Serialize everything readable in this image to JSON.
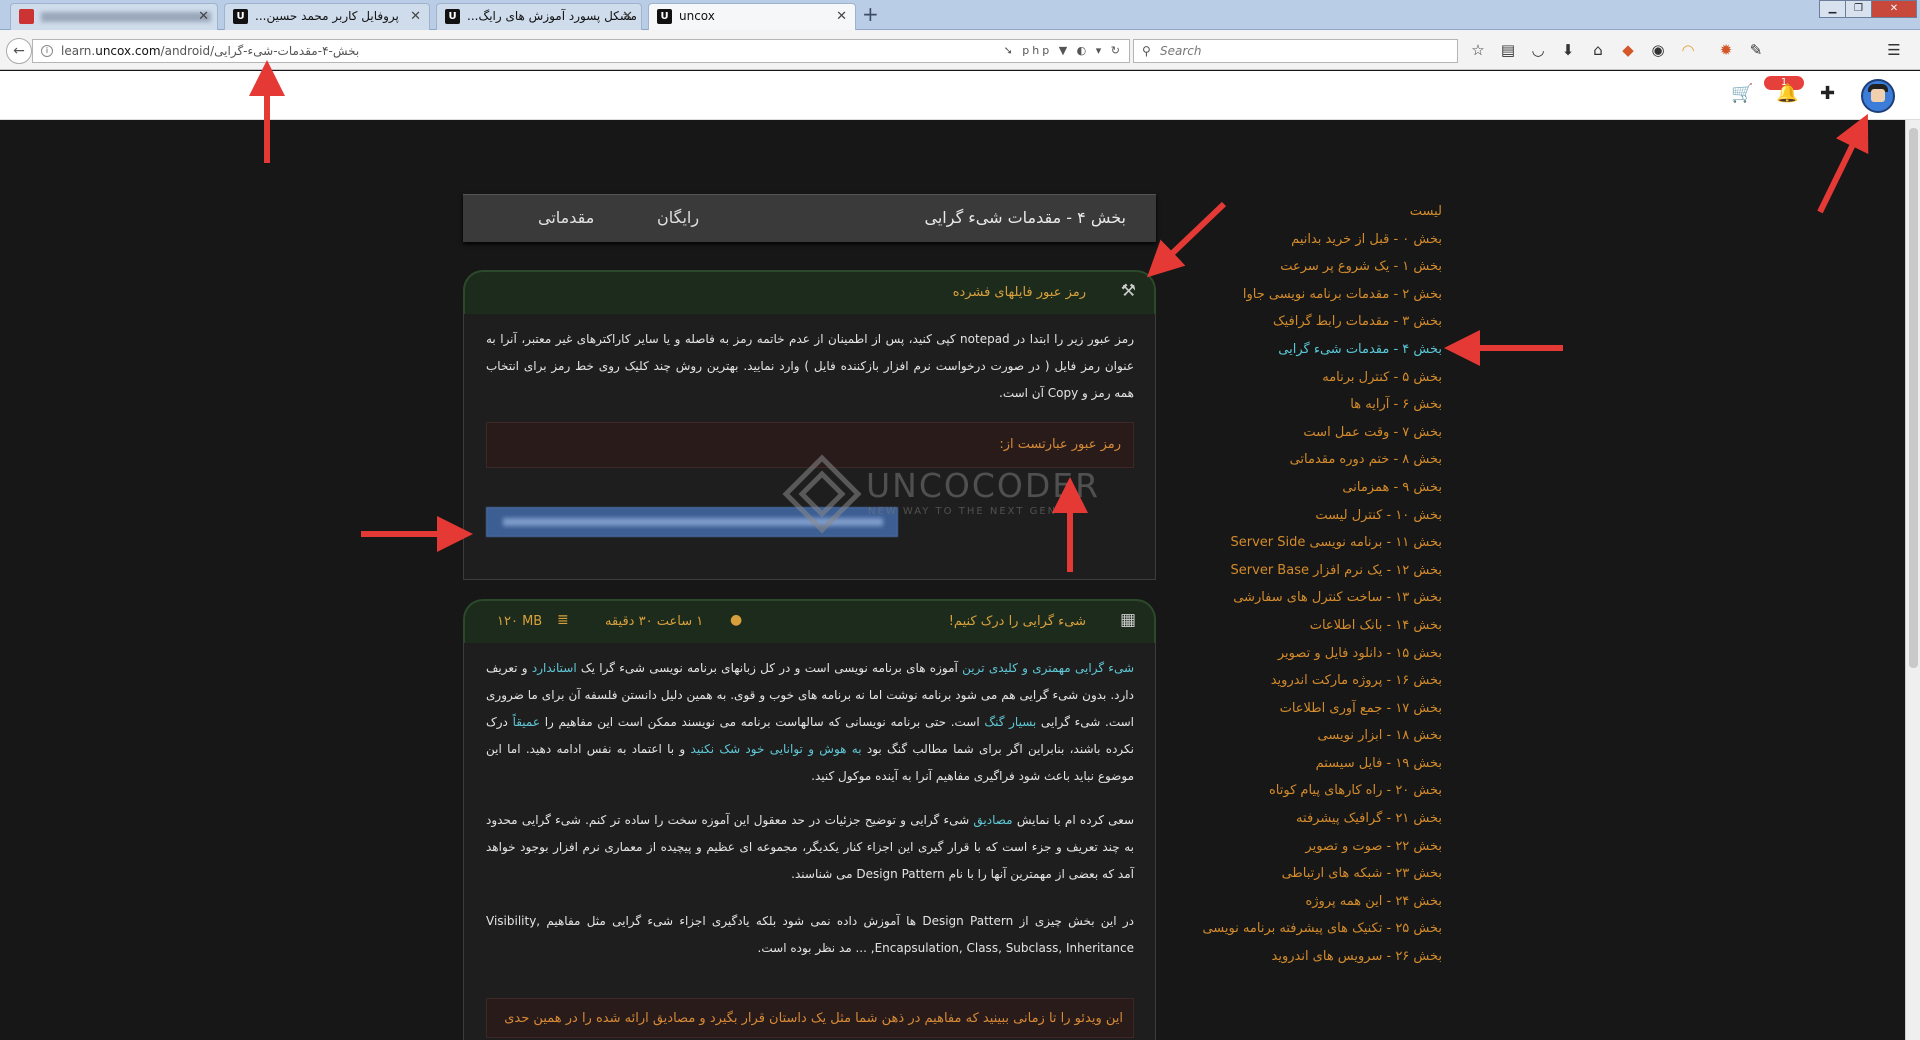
{
  "browser": {
    "tabs": [
      {
        "label": "",
        "blurred": true
      },
      {
        "label": "...پروفایل کاربر محمد حسین"
      },
      {
        "label": "...مشکل پسورد آموزش های رایگ"
      },
      {
        "label": "uncox",
        "active": true
      }
    ],
    "url": "learn.uncox.com/android/بخش-۴-مقدمات-شیء-گرایی",
    "url_domain": "uncox.com",
    "url_prefix": "learn.",
    "url_rest": "/android/بخش-۴-مقدمات-شیء-گرایی",
    "search_placeholder": "Search"
  },
  "site": {
    "notification_count": "1"
  },
  "breadcrumb": {
    "title": "بخش ۴ - مقدمات شیء گرایی",
    "free": "رایگان",
    "level": "مقدماتی"
  },
  "password_panel": {
    "title": "رمز عبور فایلهای فشرده",
    "paragraph": "رمز عبور زیر را ابتدا در notepad کپی کنید، پس از اطمینان از عدم خاتمه رمز به فاصله و یا سایر کاراکترهای غیر معتبر، آنرا به عنوان رمز فایل ( در صورت درخواست نرم افزار بازکننده فایل ) وارد نمایید. بهترین روش چند کلیک روی خط رمز برای انتخاب همه رمز و Copy آن است.",
    "pw_label": "رمز عبور عبارتست از:",
    "watermark_text": "UNCOCODER",
    "watermark_sub": "NEW WAY TO THE NEXT GEN"
  },
  "lesson_panel": {
    "title": "شیء گرایی را درک کنیم!",
    "duration": "۱ ساعت ۳۰ دقیقه",
    "size": "۱۲۰ MB",
    "p1_a": "شیء گرایی مهمتری و کلیدی ترین",
    "p1_b": " آموزه های برنامه نویسی است و در کل زبانهای برنامه نویسی شیء گرا یک ",
    "p1_c": "استاندارد",
    "p1_d": " و تعریف دارد. بدون شیء گرایی هم می شود برنامه نوشت اما نه برنامه های خوب و قوی. به همین دلیل دانستن فلسفه آن برای ما ضروری است. شیء گرایی ",
    "p1_e": "بسیار گنگ",
    "p1_f": " است. حتی برنامه نویسانی که سالهاست برنامه می نویسند ممکن است این مفاهیم را ",
    "p1_g": "عمیقاً",
    "p1_h": " درک نکرده باشند، بنابراین اگر برای شما مطالب گنگ بود ",
    "p1_i": "به هوش و توانایی خود شک نکنید",
    "p1_j": " و با اعتماد به نفس ادامه دهید. اما این موضوع نباید باعث شود فراگیری مفاهیم آنرا به آینده موکول کنید.",
    "p2_a": "سعی کرده ام با نمایش ",
    "p2_b": "مصادیق",
    "p2_c": " شیء گرایی و توضیح جزئیات در حد معقول این آموزه سخت را ساده تر کنم. شیء گرایی محدود به چند تعریف و جزء است که با قرار گیری این اجزاء کنار یکدیگر، مجموعه ای عظیم و پیچیده از معماری نرم افزار بوجود خواهد آمد که بعضی از مهمترین آنها را با نام Design Pattern می شناسند.",
    "p3": "در این بخش چیزی از Design Pattern ها آموزش داده نمی شود بلکه یادگیری اجزاء شیء گرایی مثل مفاهیم Visibility, Encapsulation, Class, Subclass, Inheritance, ... مد نظر بوده است.",
    "alert": "این ویدئو را تا زمانی ببینید که مفاهیم در ذهن شما مثل یک داستان قرار بگیرد و مصادیق ارائه شده را در همین حدی"
  },
  "sidebar": {
    "heading": "لیست",
    "items": [
      {
        "label": "بخش ۰ - قبل از خرید بدانیم"
      },
      {
        "label": "بخش ۱ - یک شروع پر سرعت"
      },
      {
        "label": "بخش ۲ - مقدمات برنامه نویسی جاوا"
      },
      {
        "label": "بخش ۳ - مقدمات رابط گرافیک"
      },
      {
        "label": "بخش ۴ - مقدمات شیء گرایی",
        "active": true
      },
      {
        "label": "بخش ۵ - کنترل برنامه"
      },
      {
        "label": "بخش ۶ - آرایه ها"
      },
      {
        "label": "بخش ۷ - وقت عمل است"
      },
      {
        "label": "بخش ۸ - ختم دوره مقدماتی"
      },
      {
        "label": "بخش ۹ - همزمانی"
      },
      {
        "label": "بخش ۱۰ - کنترل لیست"
      },
      {
        "label": "بخش ۱۱ - برنامه نویسی Server Side"
      },
      {
        "label": "بخش ۱۲ - یک نرم افزار Server Base"
      },
      {
        "label": "بخش ۱۳ - ساخت کنترل های سفارشی"
      },
      {
        "label": "بخش ۱۴ - بانک اطلاعات"
      },
      {
        "label": "بخش ۱۵ - دانلود فایل و تصویر"
      },
      {
        "label": "بخش ۱۶ - پروژه مارکت اندروید"
      },
      {
        "label": "بخش ۱۷ - جمع آوری اطلاعات"
      },
      {
        "label": "بخش ۱۸ - ابزار نویسی"
      },
      {
        "label": "بخش ۱۹ - فایل سیستم"
      },
      {
        "label": "بخش ۲۰ - راه کارهای پیام کوتاه"
      },
      {
        "label": "بخش ۲۱ - گرافیک پیشرفته"
      },
      {
        "label": "بخش ۲۲ - صوت و تصویر"
      },
      {
        "label": "بخش ۲۳ - شبکه های ارتباطی"
      },
      {
        "label": "بخش ۲۴ - این همه پروژه"
      },
      {
        "label": "بخش ۲۵ - تکنیک های پیشرفته برنامه نویسی"
      },
      {
        "label": "بخش ۲۶ - سرویس های اندروید"
      }
    ]
  },
  "colors": {
    "accent_orange": "#d38b2b",
    "accent_cyan": "#59c8d8",
    "annotation_red": "#e53935"
  }
}
